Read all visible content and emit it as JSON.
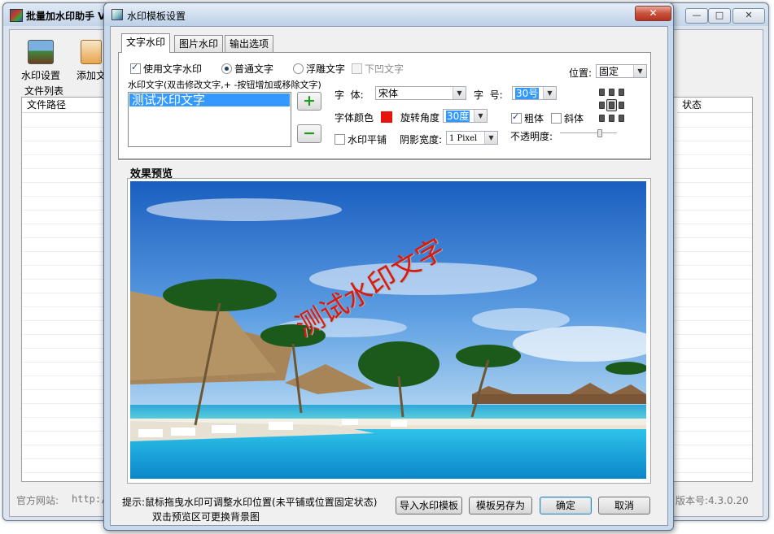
{
  "main_window": {
    "title": "批量加水印助手 V",
    "toolbar": {
      "watermark_settings": "水印设置",
      "add_files": "添加文"
    },
    "file_list": {
      "group_label": "文件列表",
      "col_path": "文件路径",
      "col_status": "状态"
    },
    "footer": {
      "website_label": "官方网站:",
      "website_url": "http:/",
      "version": "版本号:4.3.0.20"
    },
    "window_buttons": {
      "minimize": "—",
      "maximize": "□",
      "close": "✕"
    }
  },
  "dialog": {
    "title": "水印模板设置",
    "close": "✕",
    "tabs": [
      "文字水印",
      "图片水印",
      "输出选项"
    ],
    "text_tab": {
      "use_text_watermark": "使用文字水印",
      "use_text_watermark_checked": true,
      "styles": [
        {
          "label": "普通文字",
          "selected": true,
          "enabled": true
        },
        {
          "label": "浮雕文字",
          "selected": false,
          "enabled": true
        },
        {
          "label": "下凹文字",
          "selected": false,
          "enabled": false
        }
      ],
      "text_list_label": "水印文字(双击修改文字,+ -按钮增加或移除文字)",
      "text_items": [
        "测试水印文字"
      ],
      "add_button": "+",
      "remove_button": "−",
      "font_label": "字  体:",
      "font_value": "宋体",
      "size_label": "字  号:",
      "size_value": "30号",
      "color_label": "字体颜色",
      "color_value": "#e8120c",
      "rotation_label": "旋转角度",
      "rotation_value": "30度",
      "tile_label": "水印平铺",
      "tile_checked": false,
      "shadow_label": "阴影宽度:",
      "shadow_value": "1 Pixel",
      "bold_label": "粗体",
      "bold_checked": true,
      "italic_label": "斜体",
      "italic_checked": false,
      "opacity_label": "不透明度:",
      "opacity_fraction": 0.7,
      "position_label": "位置:",
      "position_value": "固定"
    },
    "preview": {
      "label": "效果预览",
      "watermark_text": "测试水印文字"
    },
    "hint_line1": "提示:鼠标拖曳水印可调整水印位置(未平铺或位置固定状态)",
    "hint_line2": "双击预览区可更换背景图",
    "buttons": {
      "import": "导入水印模板",
      "save_as": "模板另存为",
      "ok": "确定",
      "cancel": "取消"
    }
  }
}
